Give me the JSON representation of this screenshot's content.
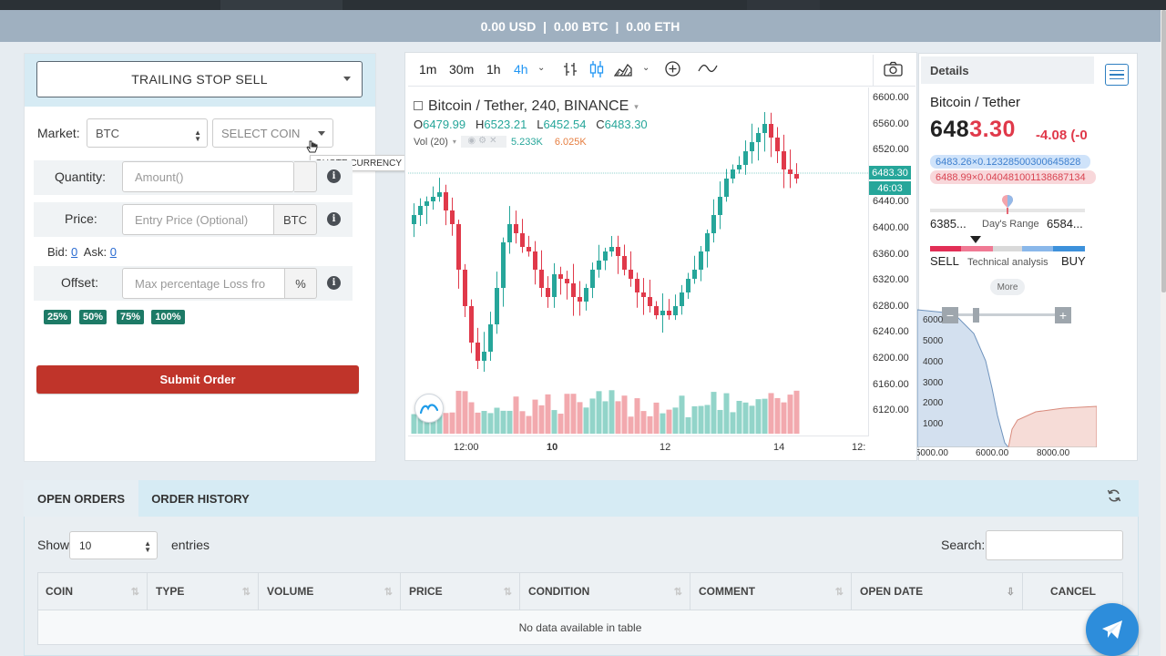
{
  "balance_bar": "0.00 USD  |  0.00 BTC  |  0.00 ETH",
  "order_form": {
    "order_type": "TRAILING STOP SELL",
    "market_label": "Market:",
    "market_value": "BTC",
    "coin_placeholder": "SELECT COIN",
    "tooltip": "QUOTE CURRENCY",
    "quantity_label": "Quantity:",
    "quantity_placeholder": "Amount()",
    "price_label": "Price:",
    "price_placeholder": "Entry Price (Optional)",
    "price_unit": "BTC",
    "bid_label": "Bid:",
    "bid_value": "0",
    "ask_label": "Ask:",
    "ask_value": "0",
    "offset_label": "Offset:",
    "offset_placeholder": "Max percentage Loss fro",
    "offset_unit": "%",
    "percent_buttons": [
      "25%",
      "50%",
      "75%",
      "100%"
    ],
    "submit": "Submit Order"
  },
  "chart": {
    "intervals": [
      "1m",
      "30m",
      "1h",
      "4h"
    ],
    "active_interval": "4h",
    "symbol_title": "Bitcoin / Tether, 240, BINANCE",
    "ohlc": {
      "o_label": "O",
      "o": "6479.99",
      "h_label": "H",
      "h": "6523.21",
      "l_label": "L",
      "l": "6452.54",
      "c_label": "C",
      "c": "6483.30"
    },
    "vol_label": "Vol (20)",
    "vol_a": "5.233K",
    "vol_b": "6.025K",
    "y_ticks": [
      "6600.00",
      "6560.00",
      "6520.00",
      "6440.00",
      "6400.00",
      "6360.00",
      "6320.00",
      "6280.00",
      "6240.00",
      "6200.00",
      "6160.00",
      "6120.00"
    ],
    "price_tag": "6483.30",
    "time_tag": "46:03",
    "x_ticks": [
      "12:00",
      "10",
      "12",
      "14",
      "12:"
    ]
  },
  "details": {
    "title": "Details",
    "pair": "Bitcoin / Tether",
    "price_main": "648",
    "price_tail": "3.30",
    "change": "-4.08 (-0",
    "bid_chip": "6483.26×0.12328500300645828",
    "ask_chip": "6488.99×0.04048100113868713​4",
    "range_low": "6385...",
    "range_label": "Day's Range",
    "range_high": "6584...",
    "sell": "SELL",
    "ta_label": "Technical analysis",
    "buy": "BUY",
    "more": "More",
    "depth_y": [
      "6000",
      "5000",
      "4000",
      "3000",
      "2000",
      "1000"
    ],
    "depth_x": [
      "5000.00",
      "6000.00",
      "8000.00"
    ]
  },
  "tables": {
    "tab_open": "OPEN ORDERS",
    "tab_history": "ORDER HISTORY",
    "show_label": "Show",
    "entries_value": "10",
    "entries_label": "entries",
    "search_label": "Search:",
    "columns": [
      "COIN",
      "TYPE",
      "VOLUME",
      "PRICE",
      "CONDITION",
      "COMMENT",
      "OPEN DATE",
      "CANCEL"
    ],
    "empty": "No data available in table"
  },
  "colors": {
    "up": "#26a69a",
    "down": "#e0394a",
    "accent": "#2d8ddb",
    "submit": "#c0342a"
  }
}
